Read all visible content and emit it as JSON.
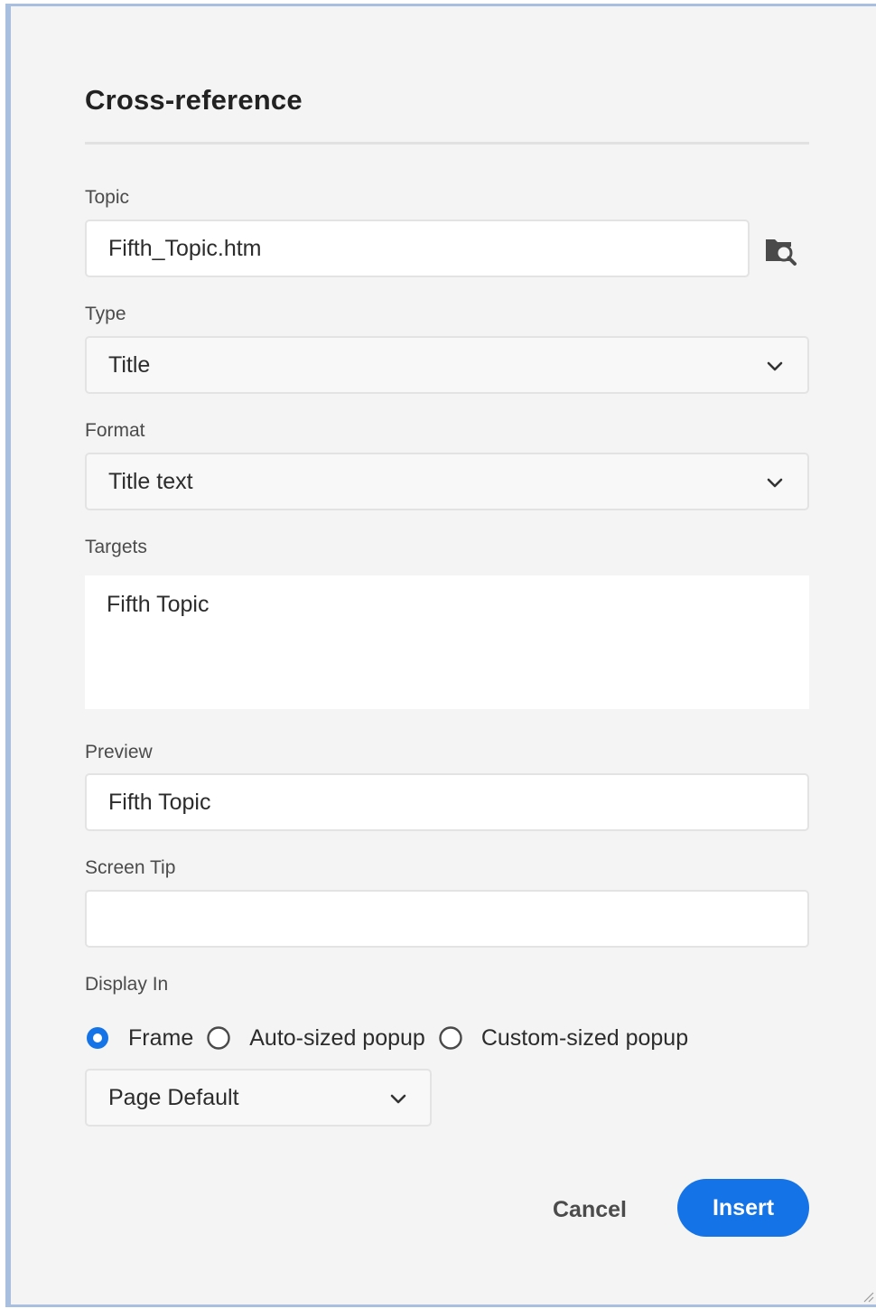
{
  "dialog": {
    "title": "Cross-reference"
  },
  "topic": {
    "label": "Topic",
    "value": "Fifth_Topic.htm",
    "browse_icon": "folder-search-icon"
  },
  "type": {
    "label": "Type",
    "value": "Title"
  },
  "format": {
    "label": "Format",
    "value": "Title text"
  },
  "targets": {
    "label": "Targets",
    "items": [
      "Fifth Topic"
    ]
  },
  "preview": {
    "label": "Preview",
    "value": "Fifth Topic"
  },
  "screen_tip": {
    "label": "Screen Tip",
    "value": ""
  },
  "display_in": {
    "label": "Display In",
    "options": [
      {
        "label": "Frame",
        "selected": true
      },
      {
        "label": "Auto-sized popup",
        "selected": false
      },
      {
        "label": "Custom-sized popup",
        "selected": false
      }
    ],
    "frame_select": "Page Default"
  },
  "buttons": {
    "cancel": "Cancel",
    "insert": "Insert"
  },
  "colors": {
    "accent": "#1473e6",
    "background": "#f4f4f4",
    "window_border": "#a9bfe0"
  }
}
